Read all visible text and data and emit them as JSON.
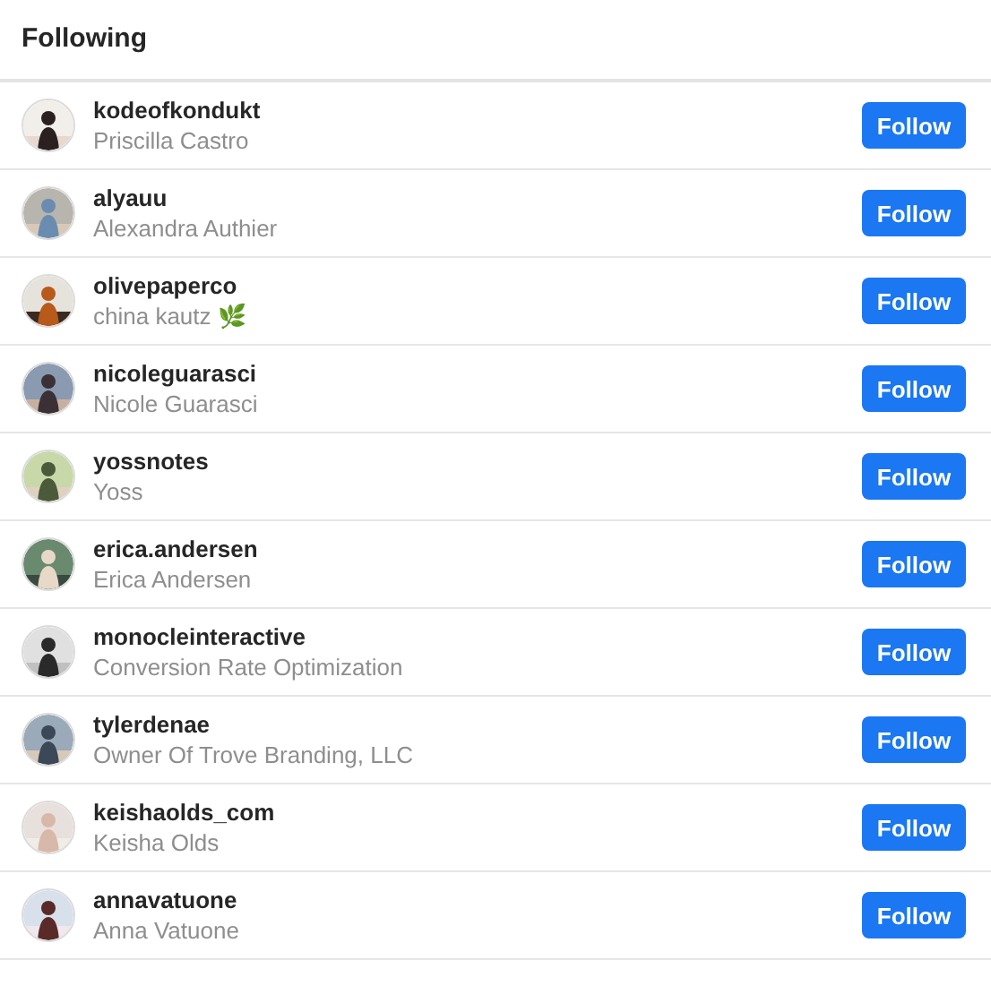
{
  "header": {
    "title": "Following"
  },
  "accounts": [
    {
      "username": "kodeofkondukt",
      "name": "Priscilla Castro",
      "button": "Follow"
    },
    {
      "username": "alyauu",
      "name": "Alexandra Authier",
      "button": "Follow"
    },
    {
      "username": "olivepaperco",
      "name": "china kautz 🌿",
      "button": "Follow"
    },
    {
      "username": "nicoleguarasci",
      "name": "Nicole Guarasci",
      "button": "Follow"
    },
    {
      "username": "yossnotes",
      "name": "Yoss",
      "button": "Follow"
    },
    {
      "username": "erica.andersen",
      "name": "Erica Andersen",
      "button": "Follow"
    },
    {
      "username": "monocleinteractive",
      "name": "Conversion Rate Optimization",
      "button": "Follow"
    },
    {
      "username": "tylerdenae",
      "name": "Owner Of Trove Branding, LLC",
      "button": "Follow"
    },
    {
      "username": "keishaolds_com",
      "name": "Keisha Olds",
      "button": "Follow"
    },
    {
      "username": "annavatuone",
      "name": "Anna Vatuone",
      "button": "Follow"
    }
  ]
}
